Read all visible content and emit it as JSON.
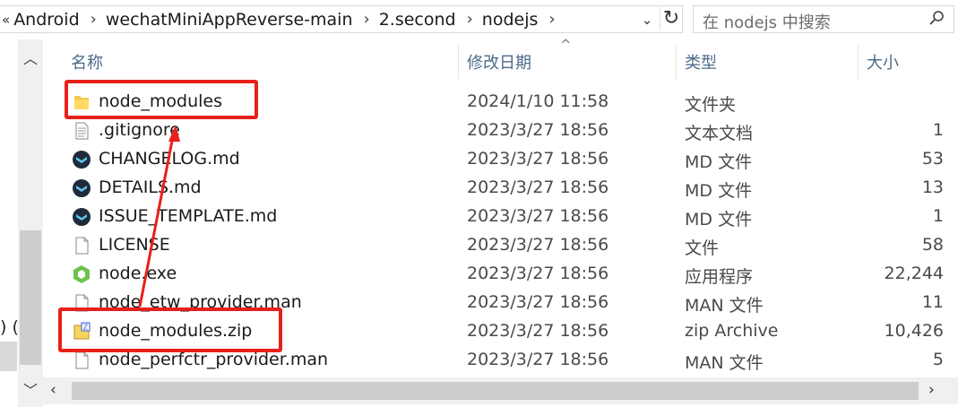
{
  "address_bar": {
    "crumbs": [
      "Android",
      "wechatMiniAppReverse-main",
      "2.second",
      "nodejs"
    ],
    "overflow_glyph": "«",
    "separator_glyph": "›",
    "dropdown_glyph": "⌄",
    "refresh_glyph": "↻"
  },
  "search": {
    "placeholder": "在 nodejs 中搜索",
    "icon": "search-icon"
  },
  "left_pane": {
    "clipped_text": ")  (("
  },
  "columns": {
    "name": "名称",
    "modified": "修改日期",
    "type": "类型",
    "size": "大小"
  },
  "files": [
    {
      "name": "node_modules",
      "modified": "2024/1/10 11:58",
      "type": "文件夹",
      "size": "",
      "icon": "folder-icon"
    },
    {
      "name": ".gitignore",
      "modified": "2023/3/27 18:56",
      "type": "文本文档",
      "size": "1",
      "icon": "text-document-icon"
    },
    {
      "name": "CHANGELOG.md",
      "modified": "2023/3/27 18:56",
      "type": "MD 文件",
      "size": "53",
      "icon": "markdown-app-icon"
    },
    {
      "name": "DETAILS.md",
      "modified": "2023/3/27 18:56",
      "type": "MD 文件",
      "size": "13",
      "icon": "markdown-app-icon"
    },
    {
      "name": "ISSUE_TEMPLATE.md",
      "modified": "2023/3/27 18:56",
      "type": "MD 文件",
      "size": "1",
      "icon": "markdown-app-icon"
    },
    {
      "name": "LICENSE",
      "modified": "2023/3/27 18:56",
      "type": "文件",
      "size": "58",
      "icon": "blank-file-icon"
    },
    {
      "name": "node.exe",
      "modified": "2023/3/27 18:56",
      "type": "应用程序",
      "size": "22,244",
      "icon": "nodejs-exe-icon"
    },
    {
      "name": "node_etw_provider.man",
      "modified": "2023/3/27 18:56",
      "type": "MAN 文件",
      "size": "11",
      "icon": "blank-file-icon"
    },
    {
      "name": "node_modules.zip",
      "modified": "2023/3/27 18:56",
      "type": "zip Archive",
      "size": "10,426",
      "icon": "zip-archive-icon"
    },
    {
      "name": "node_perfctr_provider.man",
      "modified": "2023/3/27 18:56",
      "type": "MAN 文件",
      "size": "5",
      "icon": "blank-file-icon"
    }
  ],
  "colors": {
    "highlight": "#e8201a",
    "header_text": "#4d6a8a",
    "folder": "#f2c94c"
  }
}
